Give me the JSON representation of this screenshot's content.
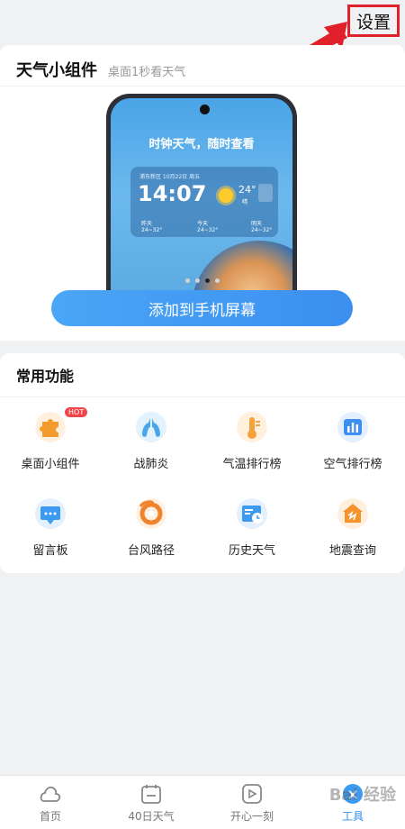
{
  "top_bar": {
    "settings_label": "设置"
  },
  "widget_card": {
    "title": "天气小组件",
    "subtitle": "桌面1秒看天气",
    "preview": {
      "headline": "时钟天气，随时查看",
      "location_line": "浦东新区 10月22日 周五",
      "time": "14:07",
      "temp": "24°",
      "condition": "晴",
      "days": [
        {
          "name": "昨天",
          "range": "24~32°"
        },
        {
          "name": "今天",
          "range": "24~32°"
        },
        {
          "name": "明天",
          "range": "24~32°"
        }
      ]
    },
    "carousel": {
      "count": 4,
      "active_index": 2
    },
    "add_button_label": "添加到手机屏幕"
  },
  "functions": {
    "title": "常用功能",
    "items": [
      {
        "label": "桌面小组件",
        "icon": "puzzle-icon",
        "badge": "HOT",
        "color": "#f59a2c"
      },
      {
        "label": "战肺炎",
        "icon": "lungs-icon",
        "color": "#4aa6ea"
      },
      {
        "label": "气温排行榜",
        "icon": "thermometer-icon",
        "color": "#f6a23a"
      },
      {
        "label": "空气排行榜",
        "icon": "air-chart-icon",
        "color": "#3c8ff0"
      },
      {
        "label": "留言板",
        "icon": "message-board-icon",
        "color": "#3c9af0"
      },
      {
        "label": "台风路径",
        "icon": "typhoon-icon",
        "color": "#f0842c"
      },
      {
        "label": "历史天气",
        "icon": "history-weather-icon",
        "color": "#3c9af0"
      },
      {
        "label": "地震查询",
        "icon": "earthquake-icon",
        "color": "#f5922c"
      }
    ]
  },
  "tabbar": {
    "active_index": 3,
    "tabs": [
      {
        "label": "首页",
        "icon": "home-cloud-icon"
      },
      {
        "label": "40日天气",
        "icon": "calendar-icon"
      },
      {
        "label": "开心一刻",
        "icon": "play-icon"
      },
      {
        "label": "工具",
        "icon": "tools-icon"
      }
    ]
  },
  "watermark_text": "Bai 经验"
}
